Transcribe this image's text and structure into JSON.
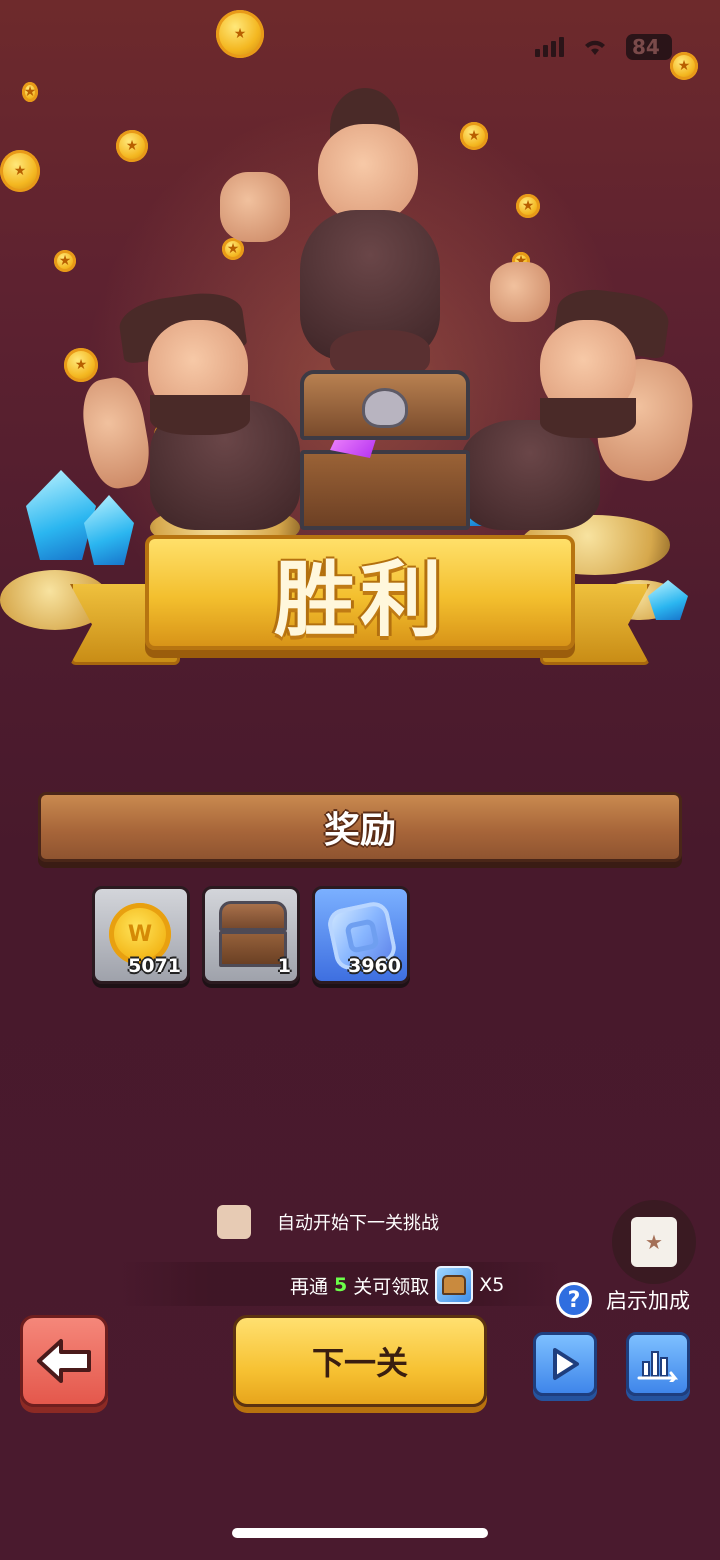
{
  "status_bar": {
    "battery": "84"
  },
  "banner": {
    "title": "胜利"
  },
  "rewards": {
    "title": "奖励",
    "items": [
      {
        "icon": "coin-icon",
        "quantity": "5071"
      },
      {
        "icon": "treasure-chest-icon",
        "quantity": "1"
      },
      {
        "icon": "gem-icon",
        "quantity": "3960"
      }
    ]
  },
  "auto_start": {
    "label": "自动开始下一关挑战",
    "checked": false
  },
  "progress": {
    "prefix": "再通",
    "count": "5",
    "suffix": "关可领取",
    "multiplier": "X5"
  },
  "boost": {
    "help": "?",
    "label": "启示加成"
  },
  "buttons": {
    "next_level": "下一关"
  },
  "colors": {
    "background": "#4e1c2e",
    "banner_gold": "#f3bf2e",
    "back_red": "#e4584c",
    "accent_blue": "#3f86ea",
    "progress_green": "#6cff4a"
  }
}
